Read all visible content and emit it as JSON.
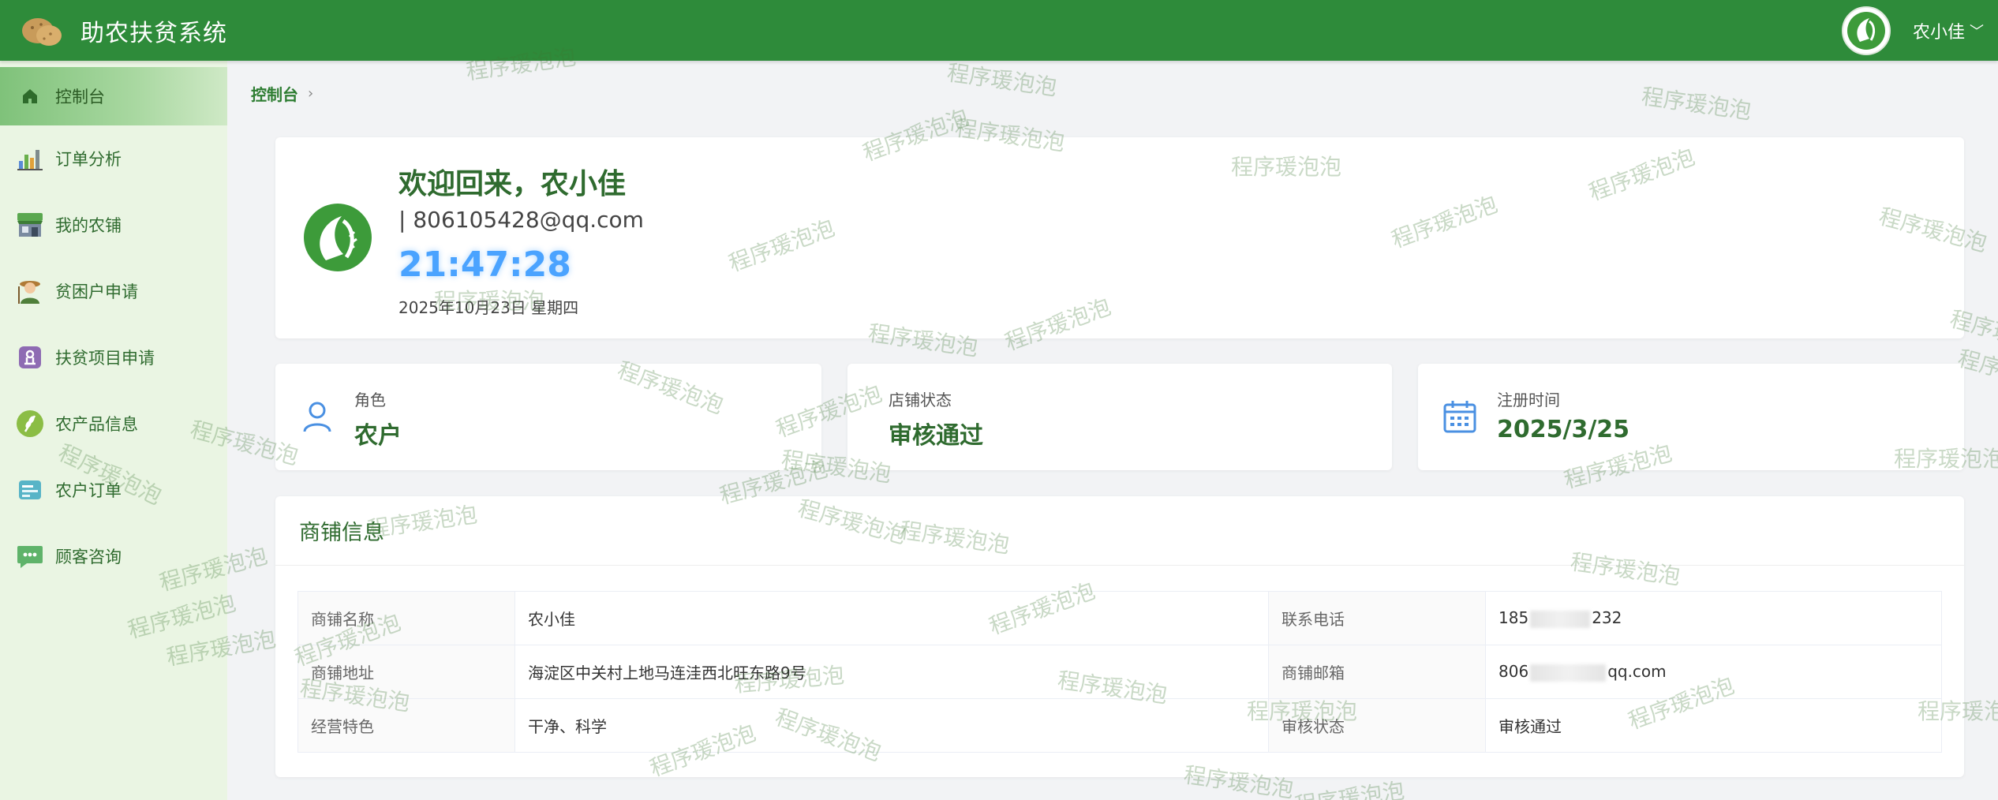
{
  "header": {
    "app_title": "助农扶贫系统",
    "user_name": "农小佳",
    "logo_icon": "potato-logo-icon",
    "avatar_icon": "green-leaf-avatar-icon"
  },
  "sidebar": {
    "items": [
      {
        "label": "控制台",
        "icon": "home-icon",
        "active": true
      },
      {
        "label": "订单分析",
        "icon": "bar-chart-icon"
      },
      {
        "label": "我的农铺",
        "icon": "shop-icon"
      },
      {
        "label": "贫困户申请",
        "icon": "farmer-icon"
      },
      {
        "label": "扶贫项目申请",
        "icon": "project-icon"
      },
      {
        "label": "农产品信息",
        "icon": "wheat-icon"
      },
      {
        "label": "农户订单",
        "icon": "order-icon"
      },
      {
        "label": "顾客咨询",
        "icon": "chat-icon"
      }
    ]
  },
  "breadcrumb": {
    "current": "控制台"
  },
  "welcome": {
    "title": "欢迎回来，农小佳",
    "email": "| 806105428@qq.com",
    "time": "21:47:28",
    "date": "2025年10月23日 星期四"
  },
  "stats": [
    {
      "label": "角色",
      "value": "农户",
      "icon": "user-icon"
    },
    {
      "label": "店铺状态",
      "value": "审核通过",
      "icon": ""
    },
    {
      "label": "注册时间",
      "value": "2025/3/25",
      "icon": "calendar-icon"
    }
  ],
  "shop": {
    "title": "商铺信息",
    "rows": [
      {
        "k1": "商铺名称",
        "v1": "农小佳",
        "k2": "联系电话",
        "v2_pre": "185",
        "v2_post": "232"
      },
      {
        "k1": "商铺地址",
        "v1": "海淀区中关村上地马连洼西北旺东路9号",
        "k2": "商铺邮箱",
        "v2_pre": "806",
        "v2_post": "qq.com"
      },
      {
        "k1": "经营特色",
        "v1": "干净、科学",
        "k2": "审核状态",
        "v2": "审核通过"
      }
    ]
  },
  "watermark": "程序瑗泡泡",
  "colors": {
    "header": "#2e8b3a",
    "sidebar": "#eaf5e3",
    "accent_text": "#2f6b2f",
    "clock": "#4aa3ff"
  }
}
